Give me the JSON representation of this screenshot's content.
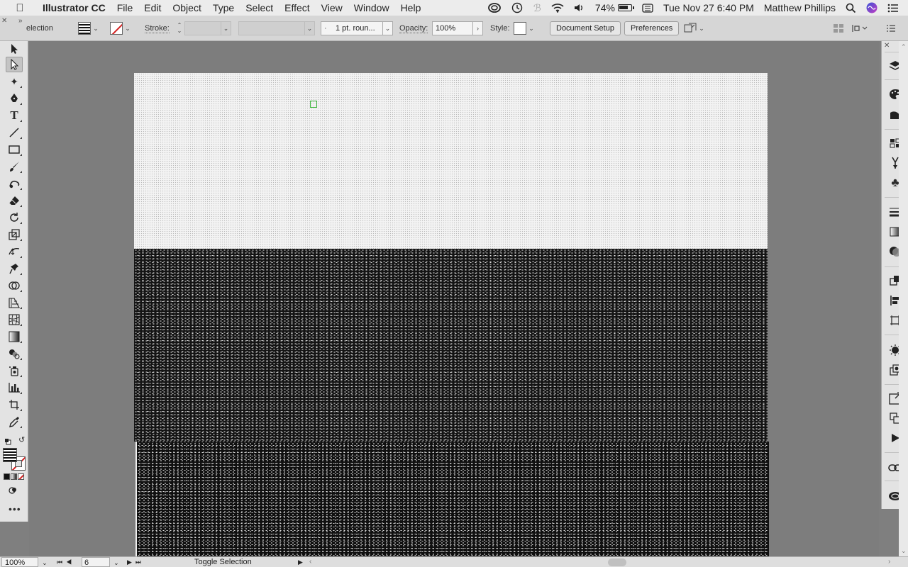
{
  "menubar": {
    "apple_icon": "apple-logo-icon",
    "app_name": "Illustrator CC",
    "menus": [
      "File",
      "Edit",
      "Object",
      "Type",
      "Select",
      "Effect",
      "View",
      "Window",
      "Help"
    ],
    "battery": "74%",
    "datetime": "Tue Nov 27  6:40 PM",
    "user": "Matthew Phillips"
  },
  "controlbar": {
    "selection_label": "election",
    "stroke_label": "Stroke:",
    "stroke_weight": "",
    "brush_field": "",
    "profile": "1 pt. roun...",
    "profile_dot": "·",
    "opacity_label": "Opacity:",
    "opacity_value": "100%",
    "style_label": "Style:",
    "document_setup": "Document Setup",
    "preferences": "Preferences"
  },
  "statusbar": {
    "zoom": "100%",
    "artboard": "6",
    "status_text": "Toggle Selection"
  },
  "colors": {
    "anchor_highlight": "#3fb83f",
    "fill_none_slash": "#d21f1f"
  }
}
